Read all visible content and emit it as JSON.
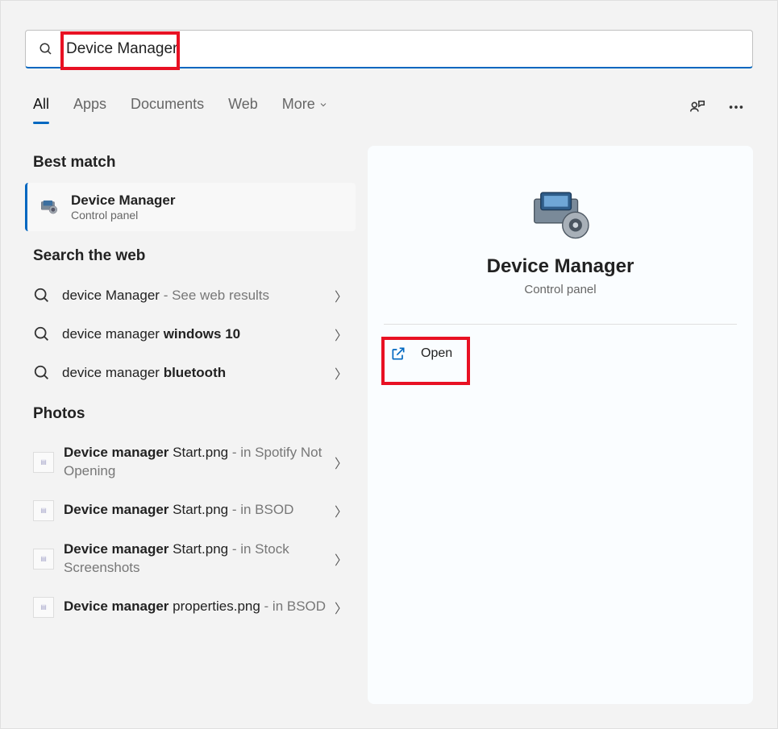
{
  "search": {
    "value": "Device Manager"
  },
  "tabs": {
    "items": [
      "All",
      "Apps",
      "Documents",
      "Web",
      "More"
    ],
    "active_index": 0
  },
  "sections": {
    "best_match": "Best match",
    "search_web": "Search the web",
    "photos": "Photos"
  },
  "best_match": {
    "title": "Device Manager",
    "subtitle": "Control panel"
  },
  "web_results": [
    {
      "prefix": "device Manager",
      "bold": "",
      "suffix": " - See web results"
    },
    {
      "prefix": "device manager ",
      "bold": "windows 10",
      "suffix": ""
    },
    {
      "prefix": "device manager ",
      "bold": "bluetooth",
      "suffix": ""
    }
  ],
  "photos": [
    {
      "name_bold": "Device manager",
      "name_rest": " Start.png",
      "loc": " - in Spotify Not Opening"
    },
    {
      "name_bold": "Device manager",
      "name_rest": " Start.png",
      "loc": " - in BSOD"
    },
    {
      "name_bold": "Device manager",
      "name_rest": " Start.png",
      "loc": " - in Stock Screenshots"
    },
    {
      "name_bold": "Device manager",
      "name_rest": " properties.png",
      "loc": " - in BSOD"
    }
  ],
  "preview": {
    "title": "Device Manager",
    "subtitle": "Control panel",
    "actions": {
      "open": "Open"
    }
  }
}
